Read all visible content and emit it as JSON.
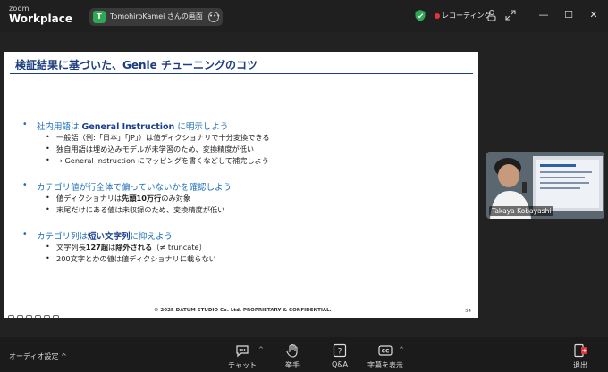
{
  "app": {
    "logo_line1": "zoom",
    "logo_line2": "Workplace"
  },
  "share": {
    "avatar_letter": "T",
    "label": "TomohiroKamei さんの画面"
  },
  "recording": {
    "label": "レコーディング"
  },
  "slide": {
    "title": "検証結果に基づいた、Genie チューニングのコツ",
    "sections": [
      {
        "head_pre": "社内用語は ",
        "head_bold": "General Instruction",
        "head_post": " に明示しよう",
        "items": [
          "一般語（例:「日本」「JP」）は値ディクショナリで十分変換できる",
          "独自用語は埋め込みモデルが未学習のため、変換精度が低い",
          "→ General Instruction にマッピングを書くなどして補完しよう"
        ]
      },
      {
        "head_pre": "カテゴリ値が行全体で偏っていないかを確認しよう",
        "head_bold": "",
        "head_post": "",
        "items": [
          "値ディクショナリは先頭10万行のみ対象",
          "末尾だけにある値は未収録のため、変換精度が低い"
        ]
      },
      {
        "head_pre": "カテゴリ列は",
        "head_bold": "短い文字列",
        "head_post": "に抑えよう",
        "items": [
          "文字列長127超は除外される（≠ truncate）",
          "200文字とかの値は値ディクショナリに載らない"
        ]
      }
    ],
    "footer": "© 2025 DATUM STUDIO Co. Ltd. PROPRIETARY & CONFIDENTIAL.",
    "page_number": "34"
  },
  "video": {
    "participant_name": "Takaya Kobayashi"
  },
  "bottom": {
    "audio_settings": "オーディオ設定",
    "chat": "チャット",
    "raise_hand": "挙手",
    "qa": "Q&A",
    "captions": "字幕を表示",
    "leave": "退出"
  },
  "colors": {
    "accent_blue": "#1f6fba",
    "title_blue": "#1c3d80",
    "recording_red": "#e5343a",
    "shield_green": "#2fa854",
    "leave_red": "#e5343a"
  }
}
